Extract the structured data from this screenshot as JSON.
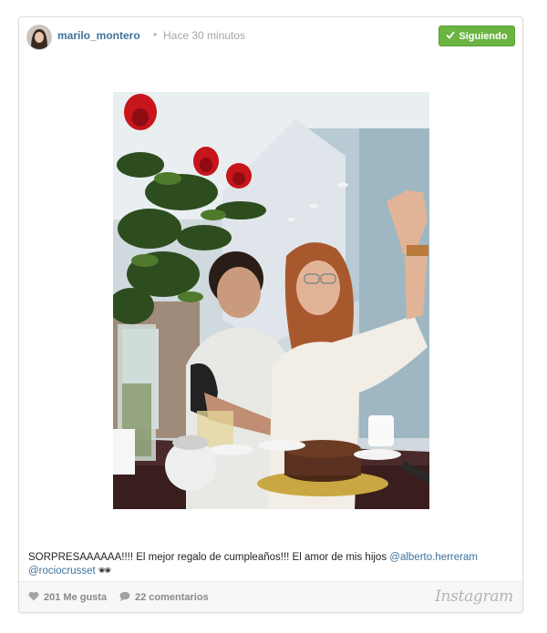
{
  "post": {
    "username": "marilo_montero",
    "separator": "•",
    "timestamp": "Hace 30 minutos",
    "follow_button": "Siguiendo",
    "caption_text": "SORPRESAAAAAA!!!! El mejor regalo de cumpleaños!!! El amor de mis hijos ",
    "mention_1": "@alberto.herreram",
    "mention_2": "@rociocrusset",
    "caption_emoji": "🕶",
    "likes": "201 Me gusta",
    "comments": "22 comentarios",
    "brand": "Instagram"
  },
  "colors": {
    "link": "#3f729b",
    "follow_green": "#6bb342",
    "muted": "#a5a7aa"
  }
}
